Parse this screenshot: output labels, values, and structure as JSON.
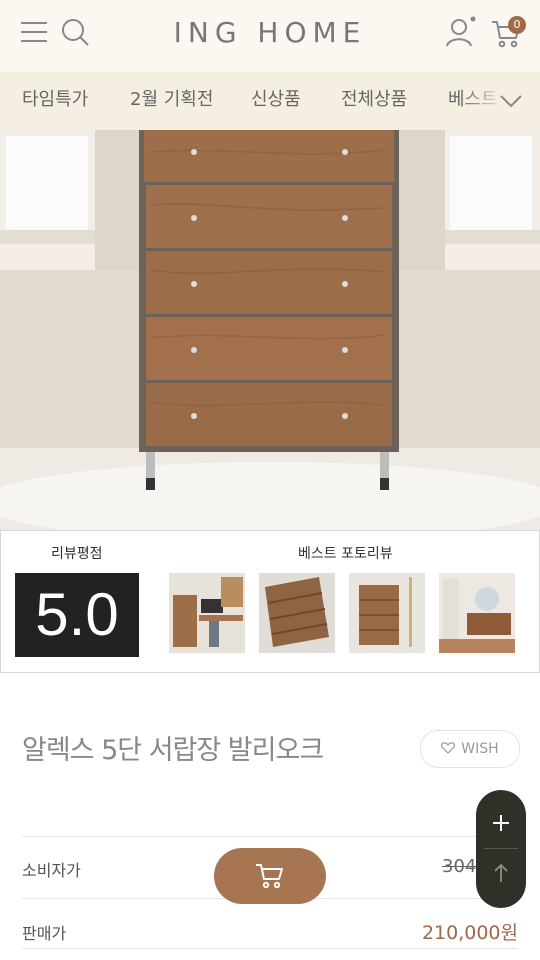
{
  "header": {
    "logo": "ING HOME",
    "cart_count": "0",
    "icons": [
      "menu-icon",
      "search-icon",
      "user-icon",
      "cart-icon"
    ]
  },
  "nav": {
    "items": [
      "타임특가",
      "2월 기획전",
      "신상품",
      "전체상품",
      "베스트"
    ]
  },
  "review": {
    "rating_label": "리뷰평점",
    "rating_value": "5.0",
    "photo_label": "베스트 포토리뷰"
  },
  "product": {
    "title": "알렉스 5단 서랍장 발리오크",
    "wish_label": "WISH",
    "consumer_price_label": "소비자가",
    "consumer_price": "304",
    "sale_price_label": "판매가",
    "sale_price": "210,000원"
  },
  "colors": {
    "accent": "#a87553",
    "header_bg": "#faf8f0",
    "nav_bg": "#f4efe1",
    "price": "#a0674a",
    "dark_pill": "#2e3128"
  }
}
